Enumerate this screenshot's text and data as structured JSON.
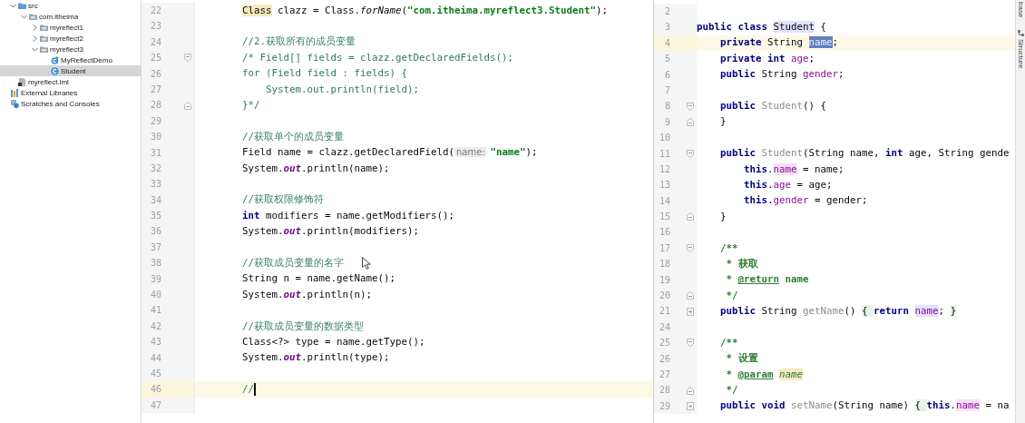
{
  "sidebar": {
    "tree": [
      {
        "label": "src",
        "kind": "source-folder",
        "expanded": true,
        "selected": false,
        "children": [
          {
            "label": "com.itheima",
            "kind": "package",
            "expanded": true,
            "selected": false,
            "children": [
              {
                "label": "myreflect1",
                "kind": "package",
                "expanded": false,
                "selected": false
              },
              {
                "label": "myreflect2",
                "kind": "package",
                "expanded": false,
                "selected": false
              },
              {
                "label": "myreflect3",
                "kind": "package",
                "expanded": true,
                "selected": false,
                "children": [
                  {
                    "label": "MyReflectDemo",
                    "kind": "main-class",
                    "selected": false
                  },
                  {
                    "label": "Student",
                    "kind": "class",
                    "selected": true
                  }
                ]
              }
            ]
          }
        ]
      },
      {
        "label": "myreflect.iml",
        "kind": "module-file",
        "selected": false
      },
      {
        "label": "External Libraries",
        "kind": "libraries",
        "selected": false
      },
      {
        "label": "Scratches and Consoles",
        "kind": "scratches",
        "selected": false
      }
    ]
  },
  "editors": [
    {
      "focused": true,
      "lines": [
        {
          "number": "22",
          "current": false,
          "kind": "body",
          "tokens": [
            {
              "text": "Class",
              "kind": "declaration-plain"
            },
            {
              "text": " clazz = Class.",
              "kind": "plain"
            },
            {
              "text": "forName",
              "kind": "italic"
            },
            {
              "text": "(",
              "kind": "plain"
            },
            {
              "text": "\"com.itheima.myreflect3.Student\"",
              "kind": "string"
            },
            {
              "text": ");",
              "kind": "plain"
            }
          ]
        },
        {
          "number": "23",
          "current": false
        },
        {
          "number": "24",
          "current": false,
          "kind": "body",
          "tokens": [
            {
              "text": "//2.获取所有的成员变量",
              "kind": "comment"
            }
          ]
        },
        {
          "number": "25",
          "current": false,
          "kind": "body",
          "fold": {
            "kind": "start"
          },
          "tokens": [
            {
              "text": "/* Field[] fields = clazz.getDeclaredFields();",
              "kind": "block-comment"
            }
          ]
        },
        {
          "number": "26",
          "current": false,
          "kind": "body",
          "tokens": [
            {
              "text": "for (Field field : fields) {",
              "kind": "block-comment"
            }
          ]
        },
        {
          "number": "27",
          "current": false,
          "kind": "nested",
          "tokens": [
            {
              "text": "System.out.println(field);",
              "kind": "block-comment"
            }
          ]
        },
        {
          "number": "28",
          "current": false,
          "kind": "body",
          "fold": {
            "kind": "end"
          },
          "tokens": [
            {
              "text": "}*/",
              "kind": "block-comment"
            }
          ]
        },
        {
          "number": "29",
          "current": false
        },
        {
          "number": "30",
          "current": false,
          "kind": "body",
          "tokens": [
            {
              "text": "//获取单个的成员变量",
              "kind": "comment"
            }
          ]
        },
        {
          "number": "31",
          "current": false,
          "kind": "body",
          "tokens": [
            {
              "text": "Field name = clazz.getDeclaredField(",
              "kind": "plain"
            },
            {
              "text": "name:",
              "kind": "hint"
            },
            {
              "text": "\"name\"",
              "kind": "string"
            },
            {
              "text": ");",
              "kind": "plain"
            }
          ]
        },
        {
          "number": "32",
          "current": false,
          "kind": "body",
          "tokens": [
            {
              "text": "System.",
              "kind": "plain"
            },
            {
              "text": "out",
              "kind": "static"
            },
            {
              "text": ".println(name);",
              "kind": "plain"
            }
          ]
        },
        {
          "number": "33",
          "current": false
        },
        {
          "number": "34",
          "current": false,
          "kind": "body",
          "tokens": [
            {
              "text": "//获取权限修饰符",
              "kind": "comment"
            }
          ]
        },
        {
          "number": "35",
          "current": false,
          "kind": "body",
          "tokens": [
            {
              "text": "int",
              "kind": "keyword"
            },
            {
              "text": " modifiers = name.getModifiers();",
              "kind": "plain"
            }
          ]
        },
        {
          "number": "36",
          "current": false,
          "kind": "body",
          "tokens": [
            {
              "text": "System.",
              "kind": "plain"
            },
            {
              "text": "out",
              "kind": "static"
            },
            {
              "text": ".println(modifiers);",
              "kind": "plain"
            }
          ]
        },
        {
          "number": "37",
          "current": false
        },
        {
          "number": "38",
          "current": false,
          "kind": "body",
          "tokens": [
            {
              "text": "//获取成员变量的名字",
              "kind": "comment"
            }
          ]
        },
        {
          "number": "39",
          "current": false,
          "kind": "body",
          "tokens": [
            {
              "text": "String n = name.getName();",
              "kind": "plain"
            }
          ]
        },
        {
          "number": "40",
          "current": false,
          "kind": "body",
          "tokens": [
            {
              "text": "System.",
              "kind": "plain"
            },
            {
              "text": "out",
              "kind": "static"
            },
            {
              "text": ".println(n);",
              "kind": "plain"
            }
          ]
        },
        {
          "number": "41",
          "current": false
        },
        {
          "number": "42",
          "current": false,
          "kind": "body",
          "tokens": [
            {
              "text": "//获取成员变量的数据类型",
              "kind": "comment"
            }
          ]
        },
        {
          "number": "43",
          "current": false,
          "kind": "body",
          "tokens": [
            {
              "text": "Class<?> type = name.getType();",
              "kind": "plain"
            }
          ]
        },
        {
          "number": "44",
          "current": false,
          "kind": "body",
          "tokens": [
            {
              "text": "System.",
              "kind": "plain"
            },
            {
              "text": "out",
              "kind": "static"
            },
            {
              "text": ".println(type);",
              "kind": "plain"
            }
          ]
        },
        {
          "number": "45",
          "current": false
        },
        {
          "number": "46",
          "current": true,
          "kind": "body",
          "tokens": [
            {
              "text": "//",
              "kind": "comment"
            }
          ]
        },
        {
          "number": "47",
          "current": false
        }
      ]
    },
    {
      "focused": false,
      "lines": [
        {
          "number": "2",
          "current": false
        },
        {
          "number": "3",
          "current": false,
          "kind": "top",
          "tokens": [
            {
              "text": "public class ",
              "kind": "keyword"
            },
            {
              "text": "Student",
              "kind": "usage-plain"
            },
            {
              "text": " {",
              "kind": "plain"
            }
          ]
        },
        {
          "number": "4",
          "current": true,
          "kind": "member",
          "tokens": [
            {
              "text": "private",
              "kind": "keyword"
            },
            {
              "text": " String ",
              "kind": "plain"
            },
            {
              "text": "name",
              "kind": "selected-field"
            },
            {
              "text": ";",
              "kind": "plain"
            }
          ]
        },
        {
          "number": "5",
          "current": false,
          "kind": "member",
          "tokens": [
            {
              "text": "private int ",
              "kind": "keyword"
            },
            {
              "text": "age",
              "kind": "field"
            },
            {
              "text": ";",
              "kind": "plain"
            }
          ]
        },
        {
          "number": "6",
          "current": false,
          "kind": "member",
          "tokens": [
            {
              "text": "public",
              "kind": "keyword"
            },
            {
              "text": " String ",
              "kind": "plain"
            },
            {
              "text": "gender",
              "kind": "field"
            },
            {
              "text": ";",
              "kind": "plain"
            }
          ]
        },
        {
          "number": "7",
          "current": false
        },
        {
          "number": "8",
          "current": false,
          "kind": "member",
          "fold": {
            "kind": "start"
          },
          "tokens": [
            {
              "text": "public ",
              "kind": "keyword"
            },
            {
              "text": "Student",
              "kind": "unused"
            },
            {
              "text": "() {",
              "kind": "plain"
            }
          ]
        },
        {
          "number": "9",
          "current": false,
          "kind": "member",
          "fold": {
            "kind": "end"
          },
          "tokens": [
            {
              "text": "}",
              "kind": "plain"
            }
          ]
        },
        {
          "number": "10",
          "current": false
        },
        {
          "number": "11",
          "current": false,
          "kind": "member",
          "fold": {
            "kind": "start"
          },
          "tokens": [
            {
              "text": "public ",
              "kind": "keyword"
            },
            {
              "text": "Student",
              "kind": "unused"
            },
            {
              "text": "(String name, ",
              "kind": "plain"
            },
            {
              "text": "int",
              "kind": "keyword"
            },
            {
              "text": " age, String gende",
              "kind": "plain"
            }
          ]
        },
        {
          "number": "12",
          "current": false,
          "kind": "body",
          "tokens": [
            {
              "text": "this",
              "kind": "keyword"
            },
            {
              "text": ".",
              "kind": "plain"
            },
            {
              "text": "name",
              "kind": "write-field"
            },
            {
              "text": " = name;",
              "kind": "plain"
            }
          ]
        },
        {
          "number": "13",
          "current": false,
          "kind": "body",
          "tokens": [
            {
              "text": "this",
              "kind": "keyword"
            },
            {
              "text": ".",
              "kind": "plain"
            },
            {
              "text": "age",
              "kind": "field"
            },
            {
              "text": " = age;",
              "kind": "plain"
            }
          ]
        },
        {
          "number": "14",
          "current": false,
          "kind": "body",
          "tokens": [
            {
              "text": "this",
              "kind": "keyword"
            },
            {
              "text": ".",
              "kind": "plain"
            },
            {
              "text": "gender",
              "kind": "field"
            },
            {
              "text": " = gender;",
              "kind": "plain"
            }
          ]
        },
        {
          "number": "15",
          "current": false,
          "kind": "member",
          "fold": {
            "kind": "end"
          },
          "tokens": [
            {
              "text": "}",
              "kind": "plain"
            }
          ]
        },
        {
          "number": "16",
          "current": false
        },
        {
          "number": "17",
          "current": false,
          "kind": "member",
          "fold": {
            "kind": "start"
          },
          "tokens": [
            {
              "text": "/**",
              "kind": "doc"
            }
          ]
        },
        {
          "number": "18",
          "current": false,
          "kind": "member",
          "tokens": [
            {
              "text": " * 获取",
              "kind": "doc"
            }
          ]
        },
        {
          "number": "19",
          "current": false,
          "kind": "member",
          "tokens": [
            {
              "text": " * ",
              "kind": "doc"
            },
            {
              "text": "@return",
              "kind": "doc-tag"
            },
            {
              "text": " name",
              "kind": "doc"
            }
          ]
        },
        {
          "number": "20",
          "current": false,
          "kind": "member",
          "fold": {
            "kind": "end"
          },
          "tokens": [
            {
              "text": " */",
              "kind": "doc"
            }
          ]
        },
        {
          "number": "21",
          "current": false,
          "kind": "member",
          "fold": {
            "kind": "collapsed"
          },
          "tokens": [
            {
              "text": "public",
              "kind": "keyword"
            },
            {
              "text": " String ",
              "kind": "plain"
            },
            {
              "text": "getName",
              "kind": "unused"
            },
            {
              "text": "() ",
              "kind": "plain"
            },
            {
              "text": "{ ",
              "kind": "brace"
            },
            {
              "text": "return ",
              "kind": "keyword"
            },
            {
              "text": "name",
              "kind": "usage-field"
            },
            {
              "text": "; ",
              "kind": "plain"
            },
            {
              "text": "}",
              "kind": "brace"
            }
          ]
        },
        {
          "number": "24",
          "current": false
        },
        {
          "number": "25",
          "current": false,
          "kind": "member",
          "fold": {
            "kind": "start"
          },
          "tokens": [
            {
              "text": "/**",
              "kind": "doc"
            }
          ]
        },
        {
          "number": "26",
          "current": false,
          "kind": "member",
          "tokens": [
            {
              "text": " * 设置",
              "kind": "doc"
            }
          ]
        },
        {
          "number": "27",
          "current": false,
          "kind": "member",
          "tokens": [
            {
              "text": " * ",
              "kind": "doc"
            },
            {
              "text": "@param",
              "kind": "doc-tag"
            },
            {
              "text": "name",
              "kind": "declaration-param"
            }
          ]
        },
        {
          "number": "28",
          "current": false,
          "kind": "member",
          "fold": {
            "kind": "end"
          },
          "tokens": [
            {
              "text": " */",
              "kind": "doc"
            }
          ]
        },
        {
          "number": "29",
          "current": false,
          "kind": "member",
          "fold": {
            "kind": "collapsed"
          },
          "tokens": [
            {
              "text": "public void ",
              "kind": "keyword"
            },
            {
              "text": "setName",
              "kind": "unused"
            },
            {
              "text": "(String name) ",
              "kind": "plain"
            },
            {
              "text": "{ ",
              "kind": "brace"
            },
            {
              "text": "this",
              "kind": "keyword"
            },
            {
              "text": ".",
              "kind": "plain"
            },
            {
              "text": "name",
              "kind": "write-field"
            },
            {
              "text": " = na",
              "kind": "plain"
            }
          ]
        }
      ]
    }
  ],
  "tool_strip": [
    {
      "label": "base",
      "kind": "plain"
    },
    {
      "label": "Structure",
      "kind": "structure"
    }
  ]
}
